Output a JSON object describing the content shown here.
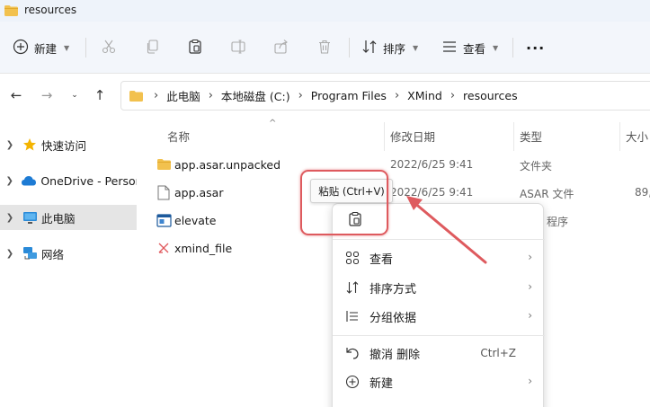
{
  "window": {
    "title": "resources"
  },
  "toolbar": {
    "new_label": "新建",
    "sort_label": "排序",
    "view_label": "查看",
    "more_label": "···"
  },
  "address": {
    "crumbs": [
      "此电脑",
      "本地磁盘 (C:)",
      "Program Files",
      "XMind",
      "resources"
    ]
  },
  "sidebar": {
    "items": [
      {
        "label": "快速访问",
        "icon": "star-icon"
      },
      {
        "label": "OneDrive - Persor",
        "icon": "cloud-icon"
      },
      {
        "label": "此电脑",
        "icon": "monitor-icon",
        "selected": true
      },
      {
        "label": "网络",
        "icon": "network-icon"
      }
    ]
  },
  "columns": {
    "name": "名称",
    "date": "修改日期",
    "type": "类型",
    "size": "大小"
  },
  "files": [
    {
      "name": "app.asar.unpacked",
      "date": "2022/6/25 9:41",
      "type": "文件夹",
      "size": "",
      "icon": "folder-icon"
    },
    {
      "name": "app.asar",
      "date": "2022/6/25 9:41",
      "type": "ASAR 文件",
      "size": "89,",
      "icon": "file-icon"
    },
    {
      "name": "elevate",
      "date": "",
      "type": "程序",
      "size": "",
      "icon": "app-icon"
    },
    {
      "name": "xmind_file",
      "date": "",
      "type": "",
      "size": "",
      "icon": "xmind-file-icon"
    }
  ],
  "tooltip": {
    "text": "粘贴 (Ctrl+V)"
  },
  "context_menu": {
    "items": [
      {
        "label": "查看",
        "icon": "grid-icon",
        "submenu": true
      },
      {
        "label": "排序方式",
        "icon": "sort-icon",
        "submenu": true
      },
      {
        "label": "分组依据",
        "icon": "group-icon",
        "submenu": true
      },
      {
        "label": "撤消 删除",
        "icon": "undo-icon",
        "shortcut": "Ctrl+Z"
      },
      {
        "label": "新建",
        "icon": "plus-circle-icon",
        "submenu": true
      }
    ]
  },
  "colors": {
    "highlight": "#de5a5e",
    "folder": "#f2c14e",
    "accent": "#0067c0"
  }
}
